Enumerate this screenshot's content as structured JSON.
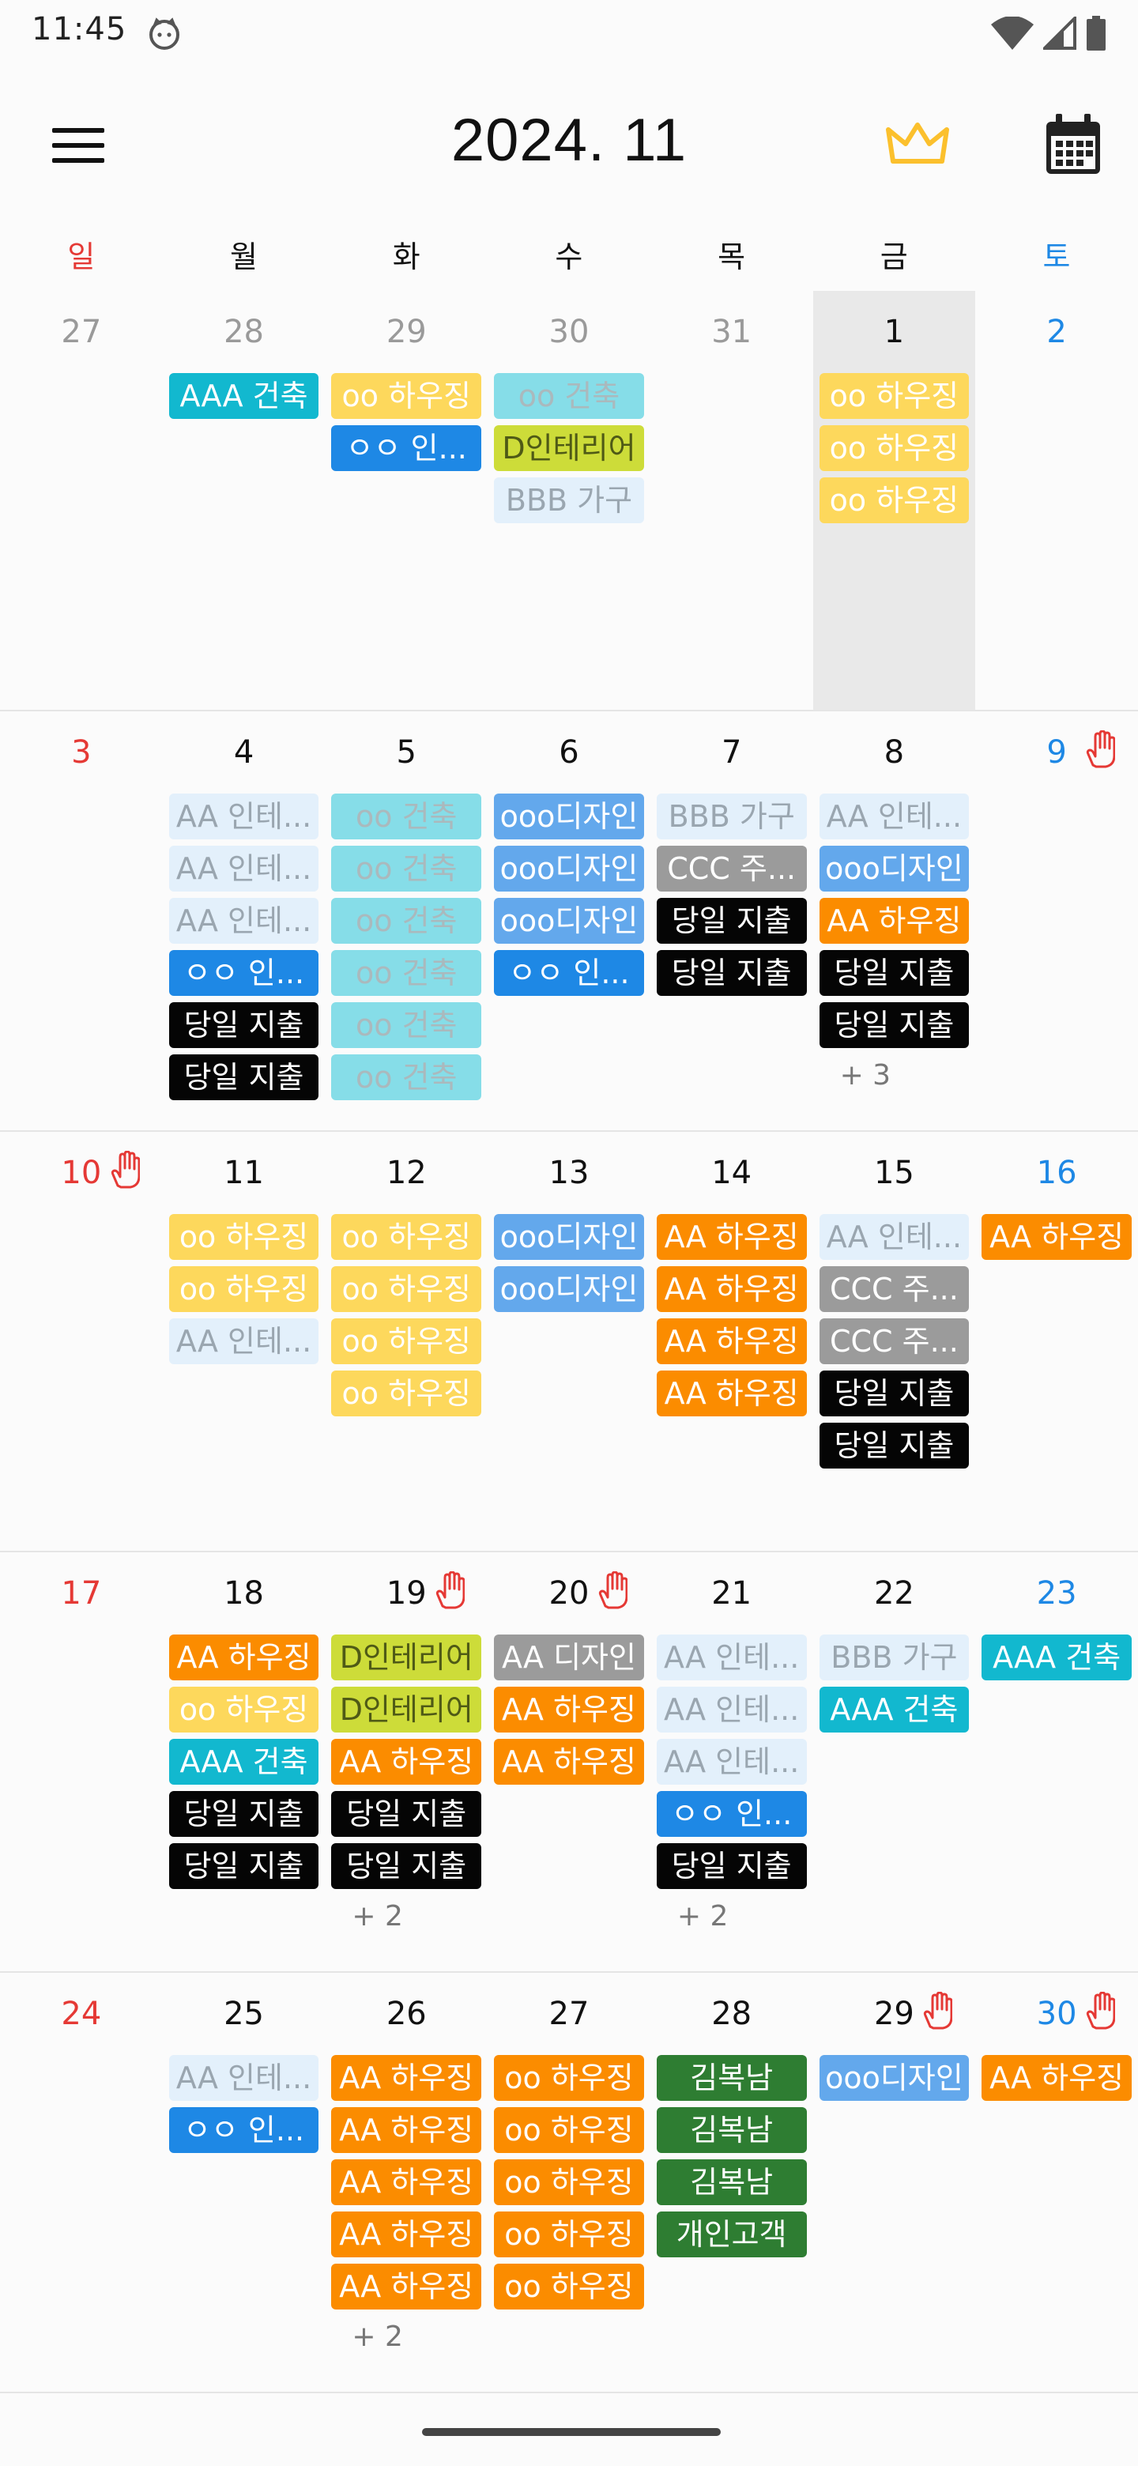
{
  "status_bar": {
    "time": "11:45"
  },
  "header": {
    "title": "2024. 11"
  },
  "weekdays": [
    "일",
    "월",
    "화",
    "수",
    "목",
    "금",
    "토"
  ],
  "colors": {
    "sunday": "#e53935",
    "saturday": "#1e88e5",
    "crown": "#fbc02d",
    "teal": "#12b8cf",
    "yellow": "#fdd85c",
    "blue": "#1e88e5",
    "light_cyan": "#86dde8",
    "lime": "#cddc39",
    "pale_blue": "#e3f0fb",
    "steel_blue": "#63a8ec",
    "gray": "#9b9b9b",
    "black": "#050505",
    "orange": "#fb8c00",
    "green": "#2e7d32"
  },
  "weeks": [
    {
      "days": [
        {
          "date": "27",
          "kind": "other",
          "events": []
        },
        {
          "date": "28",
          "kind": "other",
          "events": [
            {
              "label": "AAA 건축",
              "style": "teal"
            }
          ]
        },
        {
          "date": "29",
          "kind": "other",
          "events": [
            {
              "label": "oo 하우징",
              "style": "yellow"
            },
            {
              "label": "ㅇㅇ 인...",
              "style": "blue"
            }
          ]
        },
        {
          "date": "30",
          "kind": "other",
          "events": [
            {
              "label": "oo 건축",
              "style": "cyanlt"
            },
            {
              "label": "D인테리어",
              "style": "lime"
            },
            {
              "label": "BBB 가구",
              "style": "pale"
            }
          ]
        },
        {
          "date": "31",
          "kind": "other",
          "events": []
        },
        {
          "date": "1",
          "kind": "today",
          "events": [
            {
              "label": "oo 하우징",
              "style": "yellow"
            },
            {
              "label": "oo 하우징",
              "style": "yellow"
            },
            {
              "label": "oo 하우징",
              "style": "yellow"
            }
          ]
        },
        {
          "date": "2",
          "kind": "sat",
          "events": []
        }
      ]
    },
    {
      "days": [
        {
          "date": "3",
          "kind": "sun",
          "events": []
        },
        {
          "date": "4",
          "kind": "plain",
          "events": [
            {
              "label": "AA 인테...",
              "style": "pale"
            },
            {
              "label": "AA 인테...",
              "style": "pale"
            },
            {
              "label": "AA 인테...",
              "style": "pale"
            },
            {
              "label": "ㅇㅇ 인...",
              "style": "blue"
            },
            {
              "label": "당일 지출",
              "style": "black"
            },
            {
              "label": "당일 지출",
              "style": "black"
            }
          ]
        },
        {
          "date": "5",
          "kind": "plain",
          "events": [
            {
              "label": "oo 건축",
              "style": "cyanlt"
            },
            {
              "label": "oo 건축",
              "style": "cyanlt"
            },
            {
              "label": "oo 건축",
              "style": "cyanlt"
            },
            {
              "label": "oo 건축",
              "style": "cyanlt"
            },
            {
              "label": "oo 건축",
              "style": "cyanlt"
            },
            {
              "label": "oo 건축",
              "style": "cyanlt"
            }
          ]
        },
        {
          "date": "6",
          "kind": "plain",
          "events": [
            {
              "label": "ooo디자인",
              "style": "steel"
            },
            {
              "label": "ooo디자인",
              "style": "steel"
            },
            {
              "label": "ooo디자인",
              "style": "steel"
            },
            {
              "label": "ㅇㅇ 인...",
              "style": "blue"
            }
          ]
        },
        {
          "date": "7",
          "kind": "plain",
          "events": [
            {
              "label": "BBB 가구",
              "style": "pale"
            },
            {
              "label": "CCC 주...",
              "style": "gray"
            },
            {
              "label": "당일 지출",
              "style": "black"
            },
            {
              "label": "당일 지출",
              "style": "black"
            }
          ]
        },
        {
          "date": "8",
          "kind": "plain",
          "events": [
            {
              "label": "AA 인테...",
              "style": "pale"
            },
            {
              "label": "ooo디자인",
              "style": "steel"
            },
            {
              "label": "AA 하우징",
              "style": "orange"
            },
            {
              "label": "당일 지출",
              "style": "black"
            },
            {
              "label": "당일 지출",
              "style": "black"
            }
          ],
          "more": "+ 3"
        },
        {
          "date": "9",
          "kind": "sat",
          "hand": true,
          "events": []
        }
      ]
    },
    {
      "days": [
        {
          "date": "10",
          "kind": "sun",
          "hand": true,
          "events": []
        },
        {
          "date": "11",
          "kind": "plain",
          "events": [
            {
              "label": "oo 하우징",
              "style": "yellow"
            },
            {
              "label": "oo 하우징",
              "style": "yellow"
            },
            {
              "label": "AA 인테...",
              "style": "pale"
            }
          ]
        },
        {
          "date": "12",
          "kind": "plain",
          "events": [
            {
              "label": "oo 하우징",
              "style": "yellow"
            },
            {
              "label": "oo 하우징",
              "style": "yellow"
            },
            {
              "label": "oo 하우징",
              "style": "yellow"
            },
            {
              "label": "oo 하우징",
              "style": "yellow"
            }
          ]
        },
        {
          "date": "13",
          "kind": "plain",
          "events": [
            {
              "label": "ooo디자인",
              "style": "steel"
            },
            {
              "label": "ooo디자인",
              "style": "steel"
            }
          ]
        },
        {
          "date": "14",
          "kind": "plain",
          "events": [
            {
              "label": "AA 하우징",
              "style": "orange"
            },
            {
              "label": "AA 하우징",
              "style": "orange"
            },
            {
              "label": "AA 하우징",
              "style": "orange"
            },
            {
              "label": "AA 하우징",
              "style": "orange"
            }
          ]
        },
        {
          "date": "15",
          "kind": "plain",
          "events": [
            {
              "label": "AA 인테...",
              "style": "pale"
            },
            {
              "label": "CCC 주...",
              "style": "gray"
            },
            {
              "label": "CCC 주...",
              "style": "gray"
            },
            {
              "label": "당일 지출",
              "style": "black"
            },
            {
              "label": "당일 지출",
              "style": "black"
            }
          ]
        },
        {
          "date": "16",
          "kind": "sat",
          "events": [
            {
              "label": "AA 하우징",
              "style": "orange"
            }
          ]
        }
      ]
    },
    {
      "days": [
        {
          "date": "17",
          "kind": "sun",
          "events": []
        },
        {
          "date": "18",
          "kind": "plain",
          "events": [
            {
              "label": "AA 하우징",
              "style": "orange"
            },
            {
              "label": "oo 하우징",
              "style": "yellow"
            },
            {
              "label": "AAA 건축",
              "style": "teal"
            },
            {
              "label": "당일 지출",
              "style": "black"
            },
            {
              "label": "당일 지출",
              "style": "black"
            }
          ]
        },
        {
          "date": "19",
          "kind": "plain",
          "hand": true,
          "events": [
            {
              "label": "D인테리어",
              "style": "lime"
            },
            {
              "label": "D인테리어",
              "style": "lime"
            },
            {
              "label": "AA 하우징",
              "style": "orange"
            },
            {
              "label": "당일 지출",
              "style": "black"
            },
            {
              "label": "당일 지출",
              "style": "black"
            }
          ],
          "more": "+ 2"
        },
        {
          "date": "20",
          "kind": "plain",
          "hand": true,
          "events": [
            {
              "label": "AA 디자인",
              "style": "gray"
            },
            {
              "label": "AA 하우징",
              "style": "orange"
            },
            {
              "label": "AA 하우징",
              "style": "orange"
            }
          ]
        },
        {
          "date": "21",
          "kind": "plain",
          "events": [
            {
              "label": "AA 인테...",
              "style": "pale"
            },
            {
              "label": "AA 인테...",
              "style": "pale"
            },
            {
              "label": "AA 인테...",
              "style": "pale"
            },
            {
              "label": "ㅇㅇ 인...",
              "style": "blue"
            },
            {
              "label": "당일 지출",
              "style": "black"
            }
          ],
          "more": "+ 2"
        },
        {
          "date": "22",
          "kind": "plain",
          "events": [
            {
              "label": "BBB 가구",
              "style": "pale"
            },
            {
              "label": "AAA 건축",
              "style": "teal"
            }
          ]
        },
        {
          "date": "23",
          "kind": "sat",
          "events": [
            {
              "label": "AAA 건축",
              "style": "teal"
            }
          ]
        }
      ]
    },
    {
      "days": [
        {
          "date": "24",
          "kind": "sun",
          "events": []
        },
        {
          "date": "25",
          "kind": "plain",
          "events": [
            {
              "label": "AA 인테...",
              "style": "pale"
            },
            {
              "label": "ㅇㅇ 인...",
              "style": "blue"
            }
          ]
        },
        {
          "date": "26",
          "kind": "plain",
          "events": [
            {
              "label": "AA 하우징",
              "style": "orange"
            },
            {
              "label": "AA 하우징",
              "style": "orange"
            },
            {
              "label": "AA 하우징",
              "style": "orange"
            },
            {
              "label": "AA 하우징",
              "style": "orange"
            },
            {
              "label": "AA 하우징",
              "style": "orange"
            }
          ],
          "more": "+ 2"
        },
        {
          "date": "27",
          "kind": "plain",
          "events": [
            {
              "label": "oo 하우징",
              "style": "orange"
            },
            {
              "label": "oo 하우징",
              "style": "orange"
            },
            {
              "label": "oo 하우징",
              "style": "orange"
            },
            {
              "label": "oo 하우징",
              "style": "orange"
            },
            {
              "label": "oo 하우징",
              "style": "orange"
            }
          ]
        },
        {
          "date": "28",
          "kind": "plain",
          "events": [
            {
              "label": "김복남",
              "style": "green"
            },
            {
              "label": "김복남",
              "style": "green"
            },
            {
              "label": "김복남",
              "style": "green"
            },
            {
              "label": "개인고객",
              "style": "green"
            }
          ]
        },
        {
          "date": "29",
          "kind": "plain",
          "hand": true,
          "events": [
            {
              "label": "ooo디자인",
              "style": "steel"
            }
          ]
        },
        {
          "date": "30",
          "kind": "sat",
          "hand": true,
          "events": [
            {
              "label": "AA 하우징",
              "style": "orange"
            }
          ]
        }
      ]
    }
  ]
}
